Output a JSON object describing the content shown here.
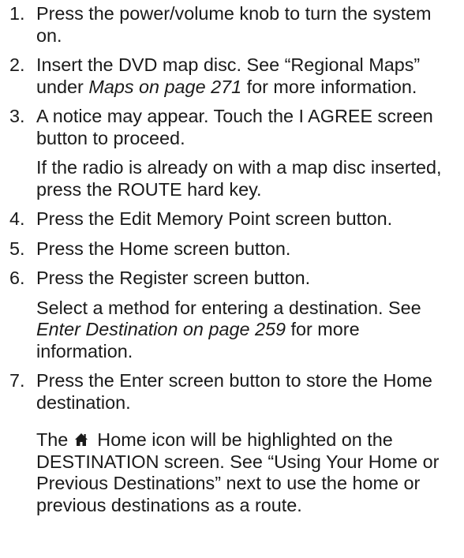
{
  "steps": [
    {
      "num": "1.",
      "text": "Press the power/volume knob to turn the system on."
    },
    {
      "num": "2.",
      "text_a": "Insert the DVD map disc. See “Regional Maps” under ",
      "ref": "Maps on page 271",
      "text_b": " for more information."
    },
    {
      "num": "3.",
      "text": "A notice may appear. Touch the I AGREE screen button to proceed.",
      "note": "If the radio is already on with a map disc inserted, press the ROUTE hard key."
    },
    {
      "num": "4.",
      "text": "Press the Edit Memory Point screen button."
    },
    {
      "num": "5.",
      "text": "Press the Home screen button."
    },
    {
      "num": "6.",
      "text": "Press the Register screen button.",
      "note_a": "Select a method for entering a destination. See ",
      "ref": "Enter Destination on page 259",
      "note_b": " for more information."
    },
    {
      "num": "7.",
      "text": "Press the Enter screen button to store the Home destination.",
      "note_a": "The ",
      "icon": "house-icon",
      "note_b": " Home icon will be highlighted on the DESTINATION screen. See “Using Your Home or Previous Destinations” next to use the home or previous destinations as a route."
    }
  ]
}
